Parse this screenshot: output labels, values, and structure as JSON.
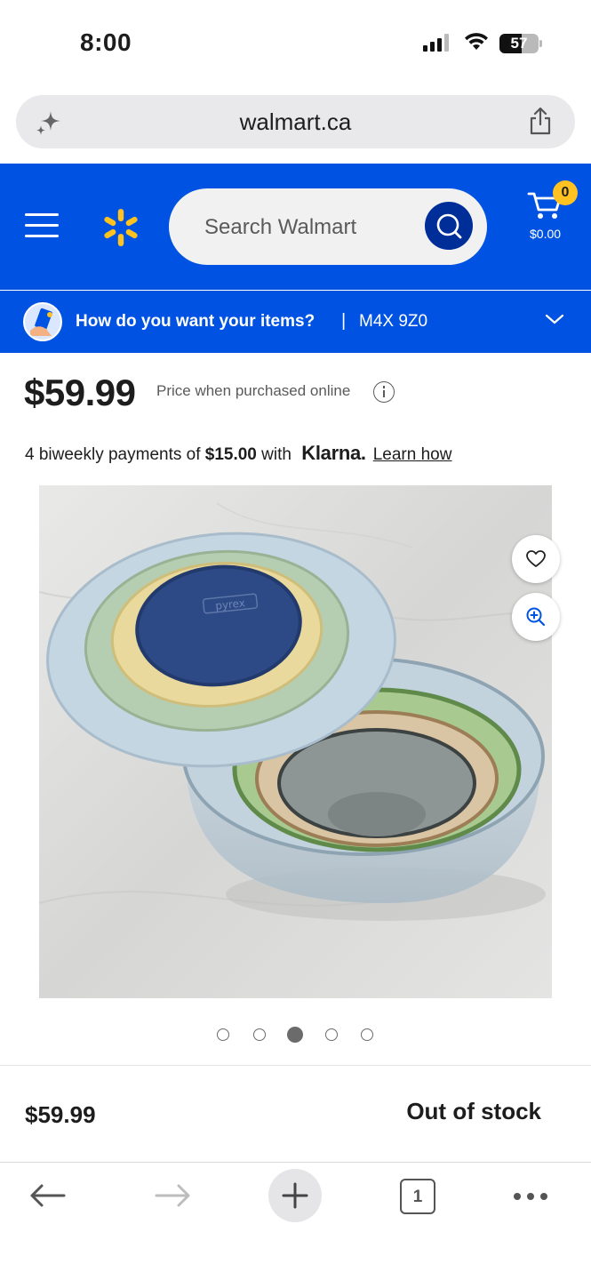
{
  "status_bar": {
    "time": "8:00",
    "battery_level": "57"
  },
  "browser": {
    "url": "walmart.ca",
    "tab_count": "1"
  },
  "header": {
    "search_placeholder": "Search Walmart",
    "cart_count": "0",
    "cart_total": "$0.00",
    "brand_color": "#0053e2",
    "spark_color": "#ffc220"
  },
  "delivery": {
    "question": "How do you want your items?",
    "separator": "|",
    "postal_code": "M4X 9Z0"
  },
  "product": {
    "price": "$59.99",
    "price_note": "Price when purchased online",
    "klarna": {
      "prefix": "4 biweekly payments of ",
      "amount": "$15.00",
      "with": " with ",
      "brand": "Klarna.",
      "learn_link": "Learn how"
    },
    "image_label": "pyrex",
    "carousel": {
      "total": 5,
      "active_index": 2
    }
  },
  "buy_bar": {
    "price": "$59.99",
    "availability": "Out of stock"
  }
}
